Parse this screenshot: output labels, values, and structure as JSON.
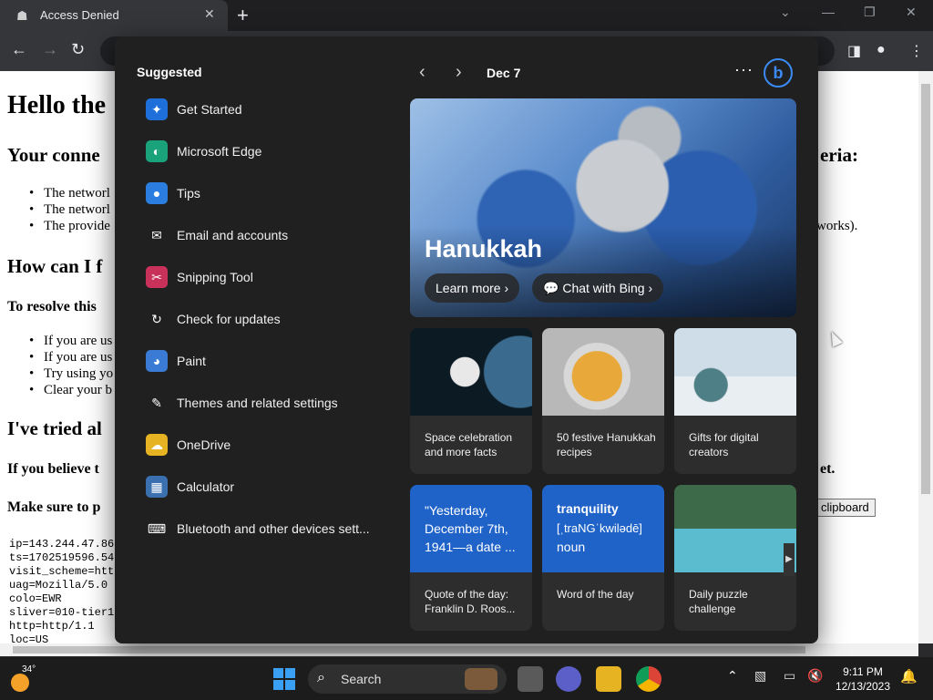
{
  "browser": {
    "tab_title": "Access Denied",
    "tab_close": "✕",
    "new_tab": "+"
  },
  "page": {
    "h1": "Hello the",
    "h2_connection": "Your conne",
    "h2_connection_right": "eria:",
    "bullets_1": [
      "The networl",
      "The networl",
      "The provide"
    ],
    "bullets_1_right": "works).",
    "h2_how": "How can I f",
    "h3_resolve": "To resolve this",
    "bullets_2": [
      "If you are us",
      "If you are us",
      "Try using yo",
      "Clear your b"
    ],
    "h2_tried": "I've tried al",
    "h3_believe": "If you believe t",
    "h3_believe_right": "et.",
    "h3_make_sure": "Make sure to p",
    "clipboard_button": "clipboard",
    "debug_lines": [
      "ip=143.244.47.86",
      "ts=1702519596.54",
      "visit_scheme=htt",
      "uag=Mozilla/5.0",
      "colo=EWR",
      "sliver=010-tier1",
      "http=http/1.1",
      "loc=US"
    ]
  },
  "flyout": {
    "suggested_title": "Suggested",
    "suggested": [
      {
        "label": "Get Started",
        "icon": "get-started-icon",
        "color": "#1e6fd9"
      },
      {
        "label": "Microsoft Edge",
        "icon": "edge-icon",
        "color": "#1aa37a"
      },
      {
        "label": "Tips",
        "icon": "tips-icon",
        "color": "#2b7de0"
      },
      {
        "label": "Email and accounts",
        "icon": "mail-icon",
        "color": "#202020"
      },
      {
        "label": "Snipping Tool",
        "icon": "snipping-tool-icon",
        "color": "#c8325a"
      },
      {
        "label": "Check for updates",
        "icon": "update-icon",
        "color": "#202020"
      },
      {
        "label": "Paint",
        "icon": "paint-icon",
        "color": "#3a7bd5"
      },
      {
        "label": "Themes and related settings",
        "icon": "brush-icon",
        "color": "#202020"
      },
      {
        "label": "OneDrive",
        "icon": "onedrive-icon",
        "color": "#e6b422"
      },
      {
        "label": "Calculator",
        "icon": "calculator-icon",
        "color": "#3a6fb0"
      },
      {
        "label": "Bluetooth and other devices sett...",
        "icon": "bluetooth-devices-icon",
        "color": "#202020"
      }
    ],
    "date": "Dec 7",
    "hero": {
      "title": "Hanukkah",
      "learn_more": "Learn more",
      "chat_with_bing": "Chat with Bing"
    },
    "cards": [
      {
        "caption": "Space celebration and more facts"
      },
      {
        "caption": "50 festive Hanukkah recipes"
      },
      {
        "caption": "Gifts for digital creators"
      }
    ],
    "quote": {
      "text": "\"Yesterday, December 7th, 1941—a date ...",
      "caption": "Quote of the day: Franklin D. Roos..."
    },
    "word": {
      "word": "tranquility",
      "pronunciation": "[ˌtraNGˈkwilədē]",
      "pos": "noun",
      "caption": "Word of the day"
    },
    "puzzle": {
      "caption": "Daily puzzle challenge"
    }
  },
  "taskbar": {
    "temperature": "34°",
    "search_label": "Search",
    "time": "9:11 PM",
    "date": "12/13/2023"
  }
}
